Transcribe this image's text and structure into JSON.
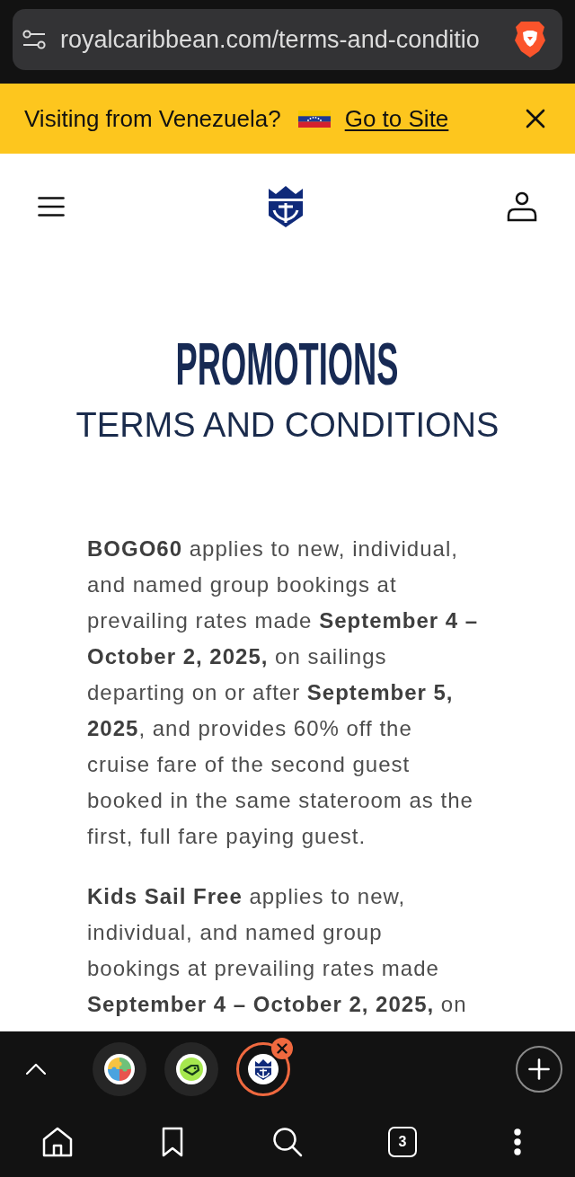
{
  "browser_toolbar": {
    "url": "royalcaribbean.com/terms-and-conditio"
  },
  "region_banner": {
    "text": "Visiting from Venezuela?",
    "link": "Go to Site"
  },
  "page": {
    "title": "PROMOTIONS",
    "subtitle": "TERMS AND CONDITIONS",
    "paragraphs": [
      "**BOGO60** applies to new, individual, and named group bookings at prevailing rates made **September 4 – October 2, 2025,** on sailings departing on or after **September 5, 2025**, and provides 60% off the cruise fare of the second guest booked in the same stateroom as the first, full fare paying guest.",
      "**Kids Sail Free** applies to new, individual, and named group bookings at prevailing rates made **September 4 – October 2, 2025,** on"
    ]
  },
  "tab_strip": {
    "tabs": [
      {
        "selected": false
      },
      {
        "selected": false
      },
      {
        "selected": true
      }
    ]
  },
  "bottom_nav": {
    "tab_count": "3"
  }
}
